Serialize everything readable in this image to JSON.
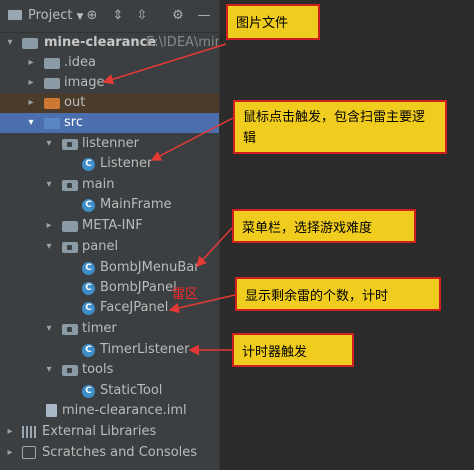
{
  "toolbar": {
    "title": "Project"
  },
  "tree": {
    "root": "mine-clearance",
    "root_path": "E:\\IDEA\\mine",
    "idea": ".idea",
    "image": "image",
    "out": "out",
    "src": "src",
    "listenner": "listenner",
    "listener": "Listener",
    "main": "main",
    "mainframe": "MainFrame",
    "metainf": "META-INF",
    "panel": "panel",
    "bombjmenubar": "BombJMenuBar",
    "bombjpanel": "BombJPanel",
    "facejpanel": "FaceJPanel",
    "timer": "timer",
    "timerlistener": "TimerListener",
    "tools": "tools",
    "statictool": "StaticTool",
    "iml": "mine-clearance.iml",
    "external_libraries": "External Libraries",
    "scratches": "Scratches and Consoles"
  },
  "annotations": {
    "image_note": "图片文件",
    "listener_note": "鼠标点击触发，包含扫雷主要逻辑",
    "menubar_note": "菜单栏，选择游戏难度",
    "bombpanel_note": "雷区",
    "facepanel_note": "显示剩余雷的个数，计时",
    "timer_note": "计时器触发"
  },
  "colors": {
    "selection": "#4b6eaf",
    "note_fill": "#f0cc1f",
    "note_border": "#d01f1f",
    "arrow": "#e53935"
  }
}
